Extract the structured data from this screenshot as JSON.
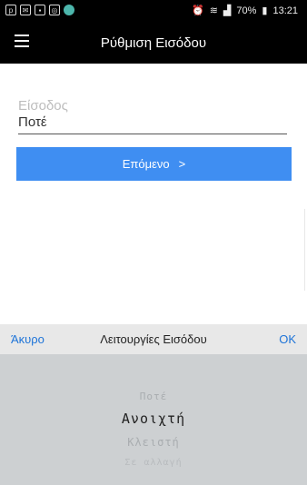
{
  "status": {
    "battery": "70%",
    "time": "13:21"
  },
  "appbar": {
    "title": "Ρύθμιση Εισόδου"
  },
  "form": {
    "label": "Είσοδος",
    "value": "Ποτέ",
    "next_label": "Επόμενο",
    "next_chevron": ">"
  },
  "picker": {
    "cancel": "Άκυρο",
    "title": "Λειτουργίες Εισόδου",
    "ok": "OK",
    "options": [
      "Ποτέ",
      "Ανοιχτή",
      "Κλειστή",
      "Σε αλλαγή"
    ],
    "selected_index": 1
  },
  "colors": {
    "accent": "#3f8ef2",
    "link": "#1e74d8",
    "appbar": "#000000",
    "picker_bg": "#cdd0d2"
  }
}
